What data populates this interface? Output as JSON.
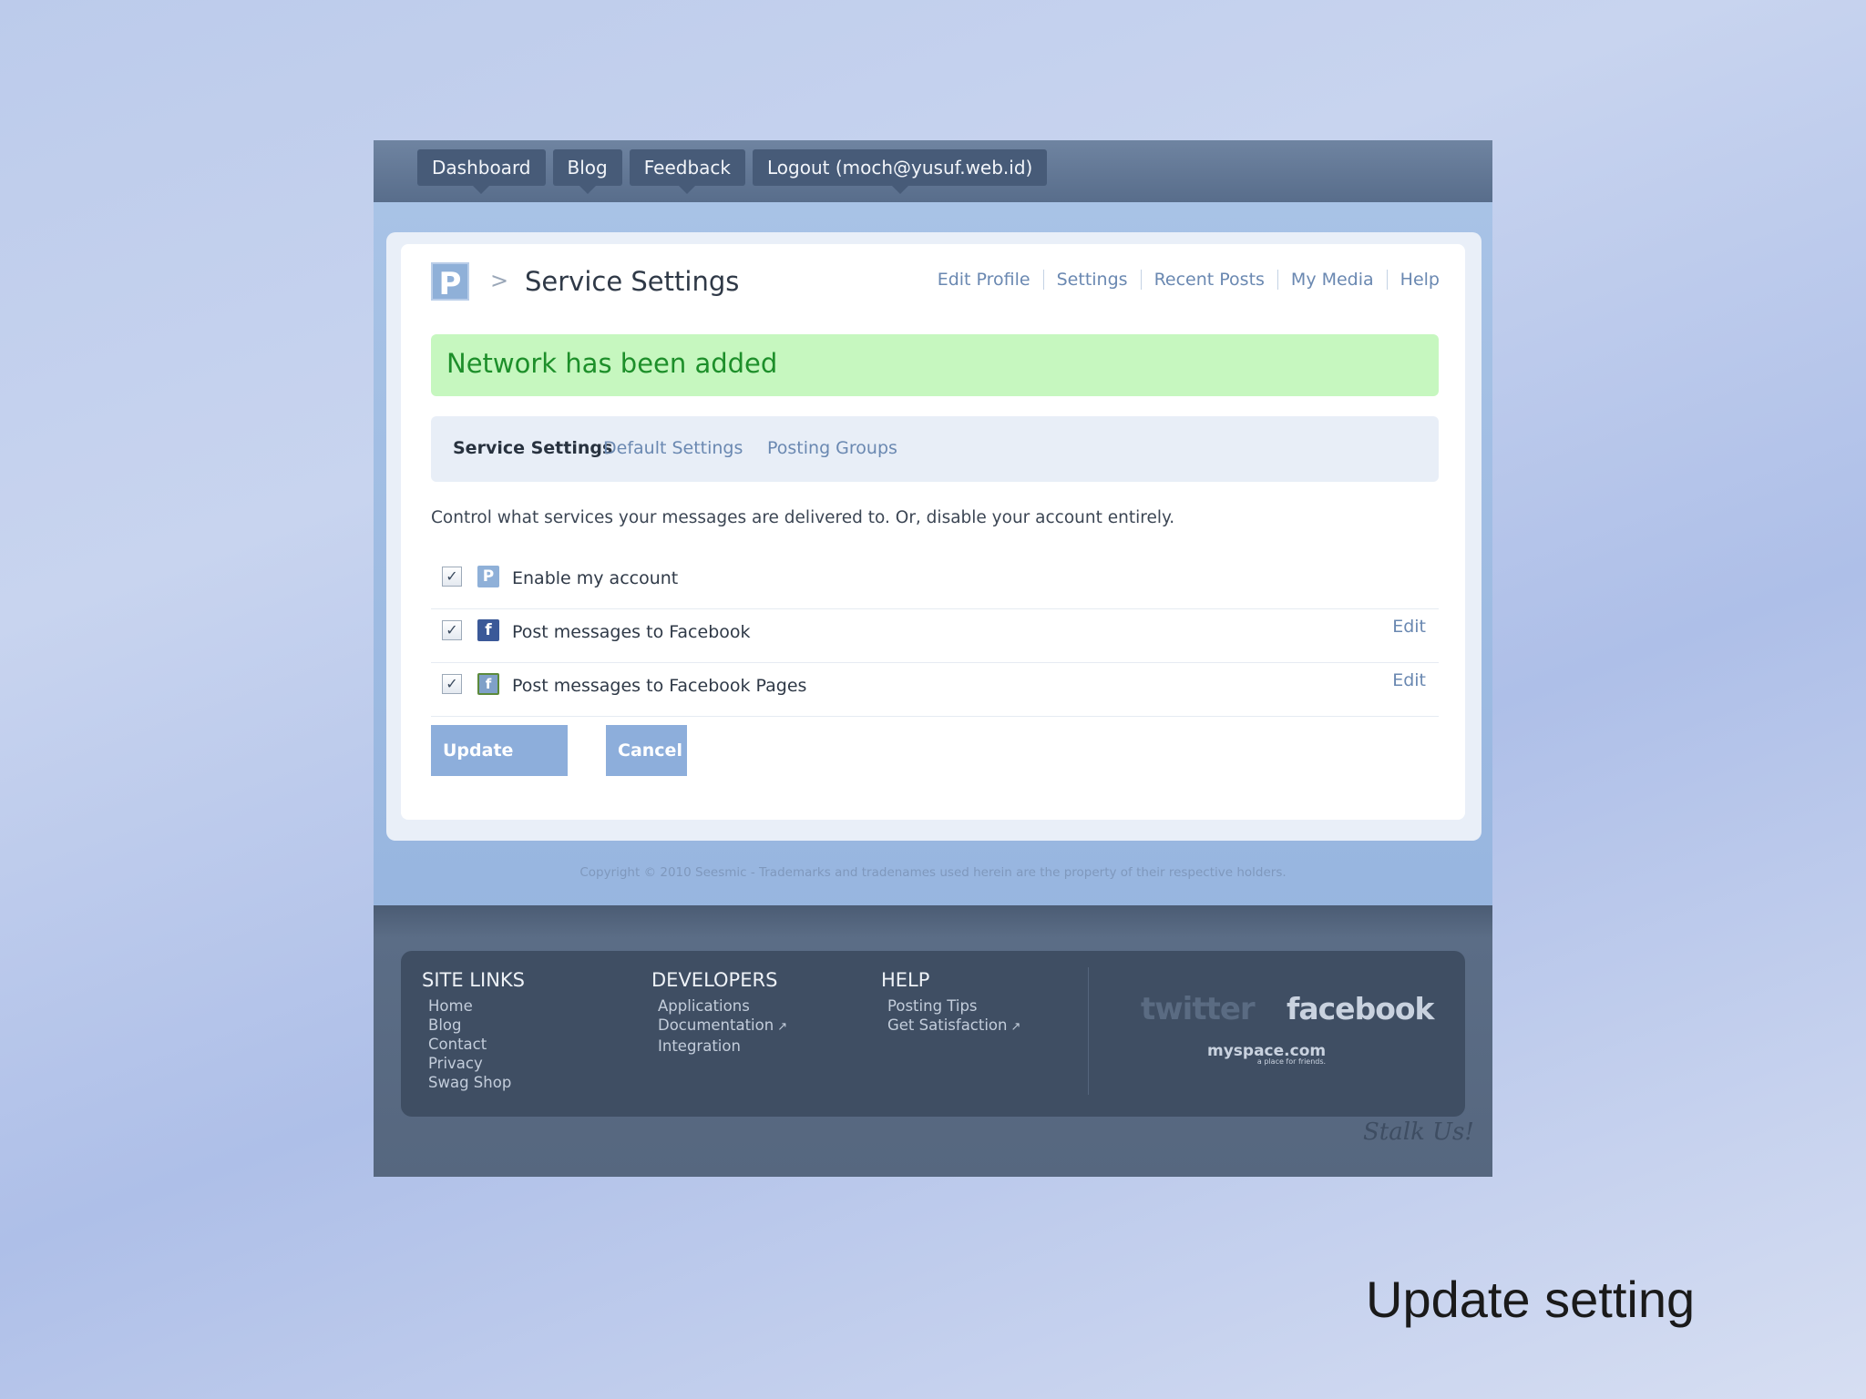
{
  "nav": [
    "Dashboard",
    "Blog",
    "Feedback",
    "Logout (moch@yusuf.web.id)"
  ],
  "logo_letter": "P",
  "breadcrumb_sep": ">",
  "page_title": "Service Settings",
  "top_links": [
    "Edit Profile",
    "Settings",
    "Recent Posts",
    "My Media",
    "Help"
  ],
  "flash": "Network has been added",
  "tabs": {
    "active": "Service Settings",
    "default": "Default Settings",
    "groups": "Posting Groups"
  },
  "description": "Control what services your messages are delivered to. Or, disable your account entirely.",
  "services": [
    {
      "label": "Enable my account",
      "icon": "posterous-icon",
      "checked": true,
      "edit": ""
    },
    {
      "label": "Post messages to Facebook",
      "icon": "facebook-icon",
      "checked": true,
      "edit": "Edit"
    },
    {
      "label": "Post messages to Facebook Pages",
      "icon": "facebook-pages-icon",
      "checked": true,
      "edit": "Edit"
    }
  ],
  "buttons": {
    "update": "Update Settings",
    "cancel": "Cancel"
  },
  "copyright": "Copyright © 2010 Seesmic - Trademarks and tradenames used herein are the property of their respective holders.",
  "footer": {
    "site_links": {
      "title": "SITE LINKS",
      "items": [
        "Home",
        "Blog",
        "Contact",
        "Privacy",
        "Swag Shop"
      ]
    },
    "developers": {
      "title": "DEVELOPERS",
      "items": [
        "Applications",
        "Documentation",
        "Integration"
      ]
    },
    "help": {
      "title": "HELP",
      "items": [
        "Posting Tips",
        "Get Satisfaction"
      ]
    },
    "social": {
      "twitter": "twitter",
      "facebook": "facebook",
      "myspace": "myspace.com",
      "myspace_tag": "a place for friends."
    },
    "stalk": "Stalk Us!"
  },
  "caption": "Update setting"
}
